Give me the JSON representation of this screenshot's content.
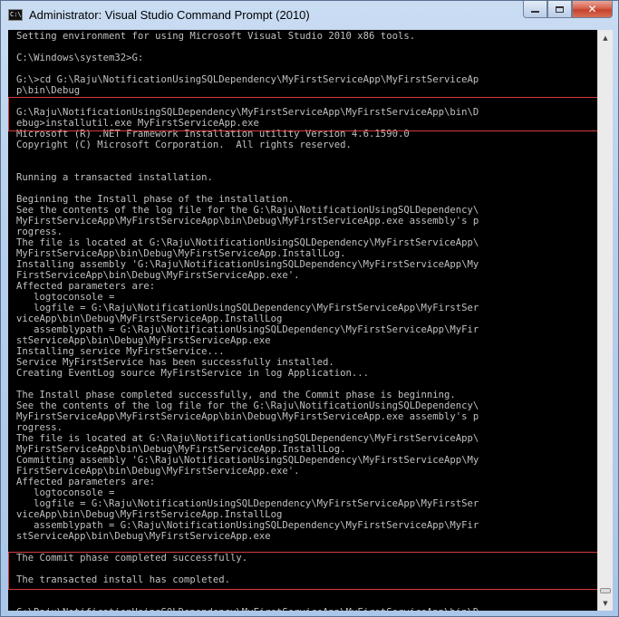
{
  "window": {
    "icon_text": "C:\\",
    "title": "Administrator: Visual Studio Command Prompt (2010)",
    "minimize_glyph": "—",
    "maximize_glyph": "▢",
    "close_glyph": "✕"
  },
  "scrollbar": {
    "up_glyph": "▲",
    "down_glyph": "▼"
  },
  "console": {
    "background": "#000000",
    "text_color": "#c0c0c0",
    "highlight_color": "#d33a3a",
    "lines": [
      "Setting environment for using Microsoft Visual Studio 2010 x86 tools.",
      "",
      "C:\\Windows\\system32>G:",
      "",
      "G:\\>cd G:\\Raju\\NotificationUsingSQLDependency\\MyFirstServiceApp\\MyFirstServiceAp",
      "p\\bin\\Debug",
      "",
      "G:\\Raju\\NotificationUsingSQLDependency\\MyFirstServiceApp\\MyFirstServiceApp\\bin\\D",
      "ebug>installutil.exe MyFirstServiceApp.exe",
      "Microsoft (R) .NET Framework Installation utility Version 4.6.1590.0",
      "Copyright (C) Microsoft Corporation.  All rights reserved.",
      "",
      "",
      "Running a transacted installation.",
      "",
      "Beginning the Install phase of the installation.",
      "See the contents of the log file for the G:\\Raju\\NotificationUsingSQLDependency\\",
      "MyFirstServiceApp\\MyFirstServiceApp\\bin\\Debug\\MyFirstServiceApp.exe assembly's p",
      "rogress.",
      "The file is located at G:\\Raju\\NotificationUsingSQLDependency\\MyFirstServiceApp\\",
      "MyFirstServiceApp\\bin\\Debug\\MyFirstServiceApp.InstallLog.",
      "Installing assembly 'G:\\Raju\\NotificationUsingSQLDependency\\MyFirstServiceApp\\My",
      "FirstServiceApp\\bin\\Debug\\MyFirstServiceApp.exe'.",
      "Affected parameters are:",
      "   logtoconsole =",
      "   logfile = G:\\Raju\\NotificationUsingSQLDependency\\MyFirstServiceApp\\MyFirstSer",
      "viceApp\\bin\\Debug\\MyFirstServiceApp.InstallLog",
      "   assemblypath = G:\\Raju\\NotificationUsingSQLDependency\\MyFirstServiceApp\\MyFir",
      "stServiceApp\\bin\\Debug\\MyFirstServiceApp.exe",
      "Installing service MyFirstService...",
      "Service MyFirstService has been successfully installed.",
      "Creating EventLog source MyFirstService in log Application...",
      "",
      "The Install phase completed successfully, and the Commit phase is beginning.",
      "See the contents of the log file for the G:\\Raju\\NotificationUsingSQLDependency\\",
      "MyFirstServiceApp\\MyFirstServiceApp\\bin\\Debug\\MyFirstServiceApp.exe assembly's p",
      "rogress.",
      "The file is located at G:\\Raju\\NotificationUsingSQLDependency\\MyFirstServiceApp\\",
      "MyFirstServiceApp\\bin\\Debug\\MyFirstServiceApp.InstallLog.",
      "Committing assembly 'G:\\Raju\\NotificationUsingSQLDependency\\MyFirstServiceApp\\My",
      "FirstServiceApp\\bin\\Debug\\MyFirstServiceApp.exe'.",
      "Affected parameters are:",
      "   logtoconsole =",
      "   logfile = G:\\Raju\\NotificationUsingSQLDependency\\MyFirstServiceApp\\MyFirstSer",
      "viceApp\\bin\\Debug\\MyFirstServiceApp.InstallLog",
      "   assemblypath = G:\\Raju\\NotificationUsingSQLDependency\\MyFirstServiceApp\\MyFir",
      "stServiceApp\\bin\\Debug\\MyFirstServiceApp.exe",
      "",
      "The Commit phase completed successfully.",
      "",
      "The transacted install has completed.",
      "",
      "",
      "G:\\Raju\\NotificationUsingSQLDependency\\MyFirstServiceApp\\MyFirstServiceApp\\bin\\D"
    ]
  }
}
